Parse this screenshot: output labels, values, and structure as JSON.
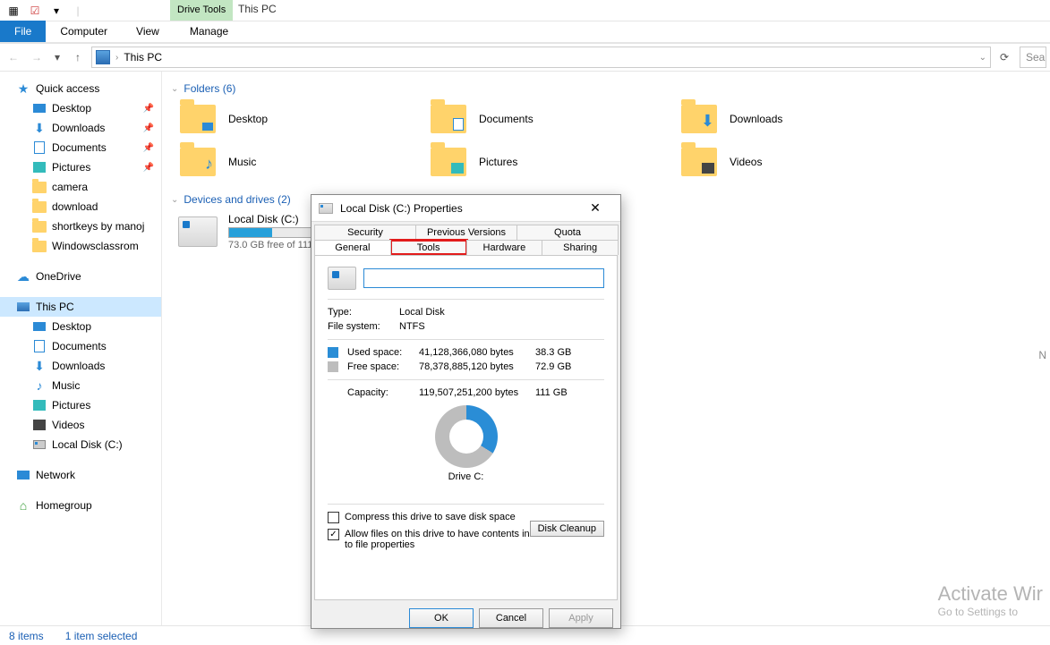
{
  "qat": {
    "title": "This PC"
  },
  "ribbon": {
    "file": "File",
    "tabs": [
      "Computer",
      "View"
    ],
    "context_group": "Drive Tools",
    "context_tab": "Manage"
  },
  "nav": {
    "location": "This PC",
    "search_placeholder": "Sea"
  },
  "sidebar": {
    "quick_access": "Quick access",
    "desktop": "Desktop",
    "downloads": "Downloads",
    "documents": "Documents",
    "pictures": "Pictures",
    "camera": "camera",
    "download_folder": "download",
    "shortkeys": "shortkeys by manoj",
    "winclass": "Windowsclassrom",
    "onedrive": "OneDrive",
    "this_pc": "This PC",
    "pc_desktop": "Desktop",
    "pc_documents": "Documents",
    "pc_downloads": "Downloads",
    "pc_music": "Music",
    "pc_pictures": "Pictures",
    "pc_videos": "Videos",
    "pc_localdisk": "Local Disk (C:)",
    "network": "Network",
    "homegroup": "Homegroup"
  },
  "content": {
    "folders_header": "Folders (6)",
    "folders": [
      "Desktop",
      "Documents",
      "Downloads",
      "Music",
      "Pictures",
      "Videos"
    ],
    "devices_header": "Devices and drives (2)",
    "drive_name": "Local Disk (C:)",
    "drive_sub": "73.0 GB free of 111 GB",
    "drive_fill_pct": 35
  },
  "status": {
    "items": "8 items",
    "selected": "1 item selected"
  },
  "watermark": {
    "line1": "Activate Wir",
    "line2": "Go to Settings to"
  },
  "right_hint": "N",
  "dialog": {
    "title": "Local Disk (C:) Properties",
    "tabs_row1": [
      "Security",
      "Previous Versions",
      "Quota"
    ],
    "tabs_row2": [
      "General",
      "Tools",
      "Hardware",
      "Sharing"
    ],
    "active_tab": "General",
    "highlighted_tab": "Tools",
    "name_value": "",
    "type_label": "Type:",
    "type_value": "Local Disk",
    "fs_label": "File system:",
    "fs_value": "NTFS",
    "used_label": "Used space:",
    "used_bytes": "41,128,366,080 bytes",
    "used_gb": "38.3 GB",
    "free_label": "Free space:",
    "free_bytes": "78,378,885,120 bytes",
    "free_gb": "72.9 GB",
    "cap_label": "Capacity:",
    "cap_bytes": "119,507,251,200 bytes",
    "cap_gb": "111 GB",
    "drive_label": "Drive C:",
    "cleanup": "Disk Cleanup",
    "compress": "Compress this drive to save disk space",
    "index": "Allow files on this drive to have contents indexed in addition to file properties",
    "ok": "OK",
    "cancel": "Cancel",
    "apply": "Apply"
  }
}
